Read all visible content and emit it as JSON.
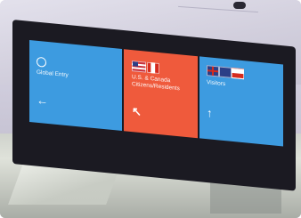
{
  "sign": {
    "tile_left": {
      "title": "Global Entry",
      "arrow": "←",
      "small": ""
    },
    "tile_middle": {
      "title_line1": "U.S. & Canada",
      "title_line2": "Citizens/Residents",
      "arrow": "↖",
      "small": ""
    },
    "tile_right": {
      "title": "Visitors",
      "arrow": "↑",
      "small": ""
    }
  },
  "colors": {
    "blue_tile": "#3d9be0",
    "orange_tile": "#ef5a3c",
    "housing": "#1b1a22"
  },
  "icons": [
    "global-entry-logo-icon",
    "left-arrow-icon",
    "up-left-arrow-icon",
    "up-arrow-icon",
    "us-flag-icon",
    "canada-flag-icon",
    "uk-flag-icon",
    "eu-flag-icon"
  ]
}
